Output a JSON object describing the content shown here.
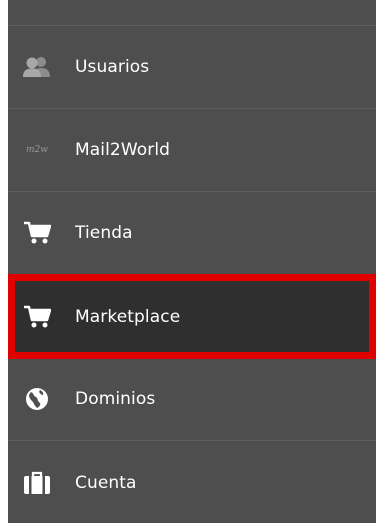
{
  "menu": {
    "items": [
      {
        "label": "Usuarios",
        "icon": "users-icon"
      },
      {
        "label": "Mail2World",
        "icon": "mail2world-logo-icon",
        "logo_text": "m2w"
      },
      {
        "label": "Tienda",
        "icon": "cart-icon"
      },
      {
        "label": "Marketplace",
        "icon": "cart-icon",
        "active": true
      },
      {
        "label": "Dominios",
        "icon": "globe-icon"
      },
      {
        "label": "Cuenta",
        "icon": "briefcase-icon"
      }
    ]
  },
  "colors": {
    "sidebar_bg": "#4e4e4e",
    "active_bg": "#2f2f2f",
    "highlight_border": "#e00000",
    "text": "#ffffff",
    "icon_muted": "#9a9a9a"
  }
}
